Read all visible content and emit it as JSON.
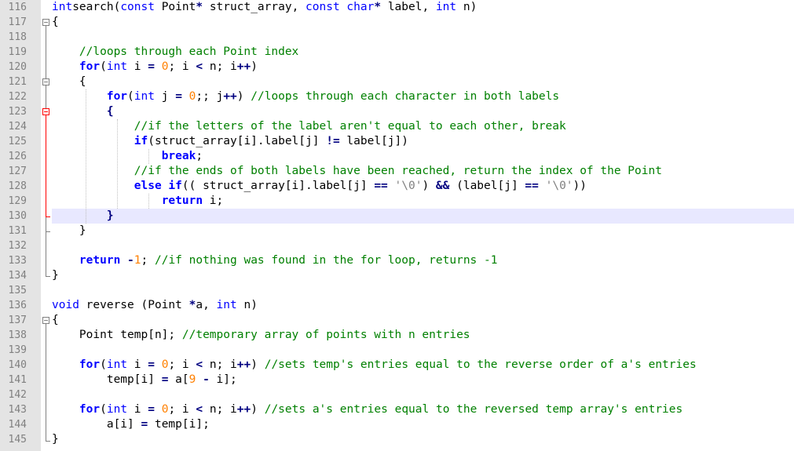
{
  "editor": {
    "lines": [
      {
        "n": "116",
        "tokens": [
          [
            "kw",
            "int"
          ],
          [
            "",
            "search("
          ],
          [
            "kw",
            "const"
          ],
          [
            "",
            " Point"
          ],
          [
            "op",
            "*"
          ],
          [
            "",
            " struct_array, "
          ],
          [
            "kw",
            "const"
          ],
          [
            "",
            ""
          ],
          [
            "kw",
            " char"
          ],
          [
            "op",
            "*"
          ],
          [
            "",
            " label, "
          ],
          [
            "kw",
            "int"
          ],
          [
            "",
            " n)"
          ]
        ]
      },
      {
        "n": "117",
        "tokens": [
          [
            "",
            "{"
          ]
        ]
      },
      {
        "n": "118",
        "tokens": []
      },
      {
        "n": "119",
        "tokens": [
          [
            "",
            "    "
          ],
          [
            "cm",
            "//loops through each Point index"
          ]
        ]
      },
      {
        "n": "120",
        "tokens": [
          [
            "",
            "    "
          ],
          [
            "kwb",
            "for"
          ],
          [
            "",
            "("
          ],
          [
            "kw",
            "int"
          ],
          [
            "",
            " i "
          ],
          [
            "op",
            "="
          ],
          [
            "",
            " "
          ],
          [
            "num",
            "0"
          ],
          [
            "",
            "; i "
          ],
          [
            "op",
            "<"
          ],
          [
            "",
            " n; i"
          ],
          [
            "op",
            "++"
          ],
          [
            "",
            ")"
          ]
        ]
      },
      {
        "n": "121",
        "tokens": [
          [
            "",
            "    {"
          ]
        ]
      },
      {
        "n": "122",
        "tokens": [
          [
            "",
            "        "
          ],
          [
            "kwb",
            "for"
          ],
          [
            "",
            "("
          ],
          [
            "kw",
            "int"
          ],
          [
            "",
            " j "
          ],
          [
            "op",
            "="
          ],
          [
            "",
            " "
          ],
          [
            "num",
            "0"
          ],
          [
            "",
            ";; j"
          ],
          [
            "op",
            "++"
          ],
          [
            "",
            ") "
          ],
          [
            "cm",
            "//loops through each character in both labels"
          ]
        ]
      },
      {
        "n": "123",
        "tokens": [
          [
            "",
            "        "
          ],
          [
            "op",
            "{"
          ]
        ]
      },
      {
        "n": "124",
        "tokens": [
          [
            "",
            "            "
          ],
          [
            "cm",
            "//if the letters of the label aren't equal to each other, break"
          ]
        ]
      },
      {
        "n": "125",
        "tokens": [
          [
            "",
            "            "
          ],
          [
            "kwb",
            "if"
          ],
          [
            "",
            "(struct_array[i].label[j] "
          ],
          [
            "op",
            "!="
          ],
          [
            "",
            " label[j])"
          ]
        ]
      },
      {
        "n": "126",
        "tokens": [
          [
            "",
            "                "
          ],
          [
            "kwb",
            "break"
          ],
          [
            "",
            ";"
          ]
        ]
      },
      {
        "n": "127",
        "tokens": [
          [
            "",
            "            "
          ],
          [
            "cm",
            "//if the ends of both labels have been reached, return the index of the Point"
          ]
        ]
      },
      {
        "n": "128",
        "tokens": [
          [
            "",
            "            "
          ],
          [
            "kwb",
            "else if"
          ],
          [
            "",
            "(( struct_array[i].label[j] "
          ],
          [
            "op",
            "=="
          ],
          [
            "",
            " "
          ],
          [
            "str",
            "'\\0'"
          ],
          [
            "",
            ") "
          ],
          [
            "op",
            "&&"
          ],
          [
            "",
            " (label[j] "
          ],
          [
            "op",
            "=="
          ],
          [
            "",
            " "
          ],
          [
            "str",
            "'\\0'"
          ],
          [
            "",
            "))"
          ]
        ]
      },
      {
        "n": "129",
        "tokens": [
          [
            "",
            "                "
          ],
          [
            "kwb",
            "return"
          ],
          [
            "",
            " i;"
          ]
        ]
      },
      {
        "n": "130",
        "tokens": [
          [
            "",
            "        "
          ],
          [
            "op",
            "}"
          ]
        ]
      },
      {
        "n": "131",
        "tokens": [
          [
            "",
            "    }"
          ]
        ]
      },
      {
        "n": "132",
        "tokens": []
      },
      {
        "n": "133",
        "tokens": [
          [
            "",
            "    "
          ],
          [
            "kwb",
            "return"
          ],
          [
            "",
            " "
          ],
          [
            "op",
            "-"
          ],
          [
            "num",
            "1"
          ],
          [
            "",
            "; "
          ],
          [
            "cm",
            "//if nothing was found in the for loop, returns -1"
          ]
        ]
      },
      {
        "n": "134",
        "tokens": [
          [
            "",
            "}"
          ]
        ]
      },
      {
        "n": "135",
        "tokens": []
      },
      {
        "n": "136",
        "tokens": [
          [
            "kw",
            "void"
          ],
          [
            "",
            " reverse (Point "
          ],
          [
            "op",
            "*"
          ],
          [
            "",
            "a, "
          ],
          [
            "kw",
            "int"
          ],
          [
            "",
            " n)"
          ]
        ]
      },
      {
        "n": "137",
        "tokens": [
          [
            "",
            "{"
          ]
        ]
      },
      {
        "n": "138",
        "tokens": [
          [
            "",
            "    Point temp[n]; "
          ],
          [
            "cm",
            "//temporary array of points with n entries"
          ]
        ]
      },
      {
        "n": "139",
        "tokens": []
      },
      {
        "n": "140",
        "tokens": [
          [
            "",
            "    "
          ],
          [
            "kwb",
            "for"
          ],
          [
            "",
            "("
          ],
          [
            "kw",
            "int"
          ],
          [
            "",
            " i "
          ],
          [
            "op",
            "="
          ],
          [
            "",
            " "
          ],
          [
            "num",
            "0"
          ],
          [
            "",
            "; i "
          ],
          [
            "op",
            "<"
          ],
          [
            "",
            " n; i"
          ],
          [
            "op",
            "++"
          ],
          [
            "",
            ") "
          ],
          [
            "cm",
            "//sets temp's entries equal to the reverse order of a's entries"
          ]
        ]
      },
      {
        "n": "141",
        "tokens": [
          [
            "",
            "        temp[i] "
          ],
          [
            "op",
            "="
          ],
          [
            "",
            " a["
          ],
          [
            "num",
            "9"
          ],
          [
            "",
            " "
          ],
          [
            "op",
            "-"
          ],
          [
            "",
            " i];"
          ]
        ]
      },
      {
        "n": "142",
        "tokens": []
      },
      {
        "n": "143",
        "tokens": [
          [
            "",
            "    "
          ],
          [
            "kwb",
            "for"
          ],
          [
            "",
            "("
          ],
          [
            "kw",
            "int"
          ],
          [
            "",
            " i "
          ],
          [
            "op",
            "="
          ],
          [
            "",
            " "
          ],
          [
            "num",
            "0"
          ],
          [
            "",
            "; i "
          ],
          [
            "op",
            "<"
          ],
          [
            "",
            " n; i"
          ],
          [
            "op",
            "++"
          ],
          [
            "",
            ") "
          ],
          [
            "cm",
            "//sets a's entries equal to the reversed temp array's entries"
          ]
        ]
      },
      {
        "n": "144",
        "tokens": [
          [
            "",
            "        a[i] "
          ],
          [
            "op",
            "="
          ],
          [
            "",
            " temp[i];"
          ]
        ]
      },
      {
        "n": "145",
        "tokens": [
          [
            "",
            "}"
          ]
        ]
      }
    ],
    "current_line": "130"
  },
  "colors": {
    "keyword": "#0000ff",
    "comment": "#008000",
    "number": "#ff8000",
    "string": "#808080",
    "operator": "#000080",
    "current_line_bg": "#e8e8ff",
    "gutter_bg": "#e4e4e4",
    "fold_active": "#ff0000"
  }
}
